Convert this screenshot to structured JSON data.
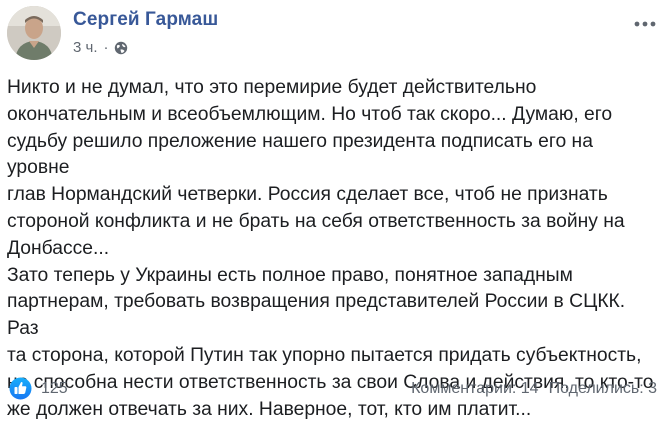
{
  "post": {
    "author": "Сергей Гармаш",
    "time": "3 ч.",
    "separator": "·",
    "text": "Никто и не думал, что это перемирие будет действительно\nокончательным и всеобъемлющим. Но чтоб так скоро... Думаю, его\nсудьбу решило преложение нашего президента подписать его на уровне\nглав Нормандский четверки. Россия сделает все, чтоб не признать\nстороной конфликта и не брать на себя ответственность за войну на\nДонбассе...\nЗато теперь у Украины есть полное право, понятное западным\nпартнерам, требовать возвращения представителей России в СЦКК. Раз\nта сторона, которой Путин так упорно пытается придать субъектность,\nне способна нести ответственность за свои Слова и действия, то кто-то\nже должен отвечать за них. Наверное, тот, кто им платит...",
    "reactions_count": "125",
    "comments": "Комментарии: 14",
    "shares": "Поделились: 3"
  },
  "colors": {
    "author": "#385898",
    "meta": "#606770",
    "text": "#1c1e21",
    "like_blue": "#1877f2"
  },
  "icons": {
    "avatar": "avatar",
    "privacy": "globe-icon",
    "menu": "more-icon",
    "reaction": "like-icon"
  }
}
